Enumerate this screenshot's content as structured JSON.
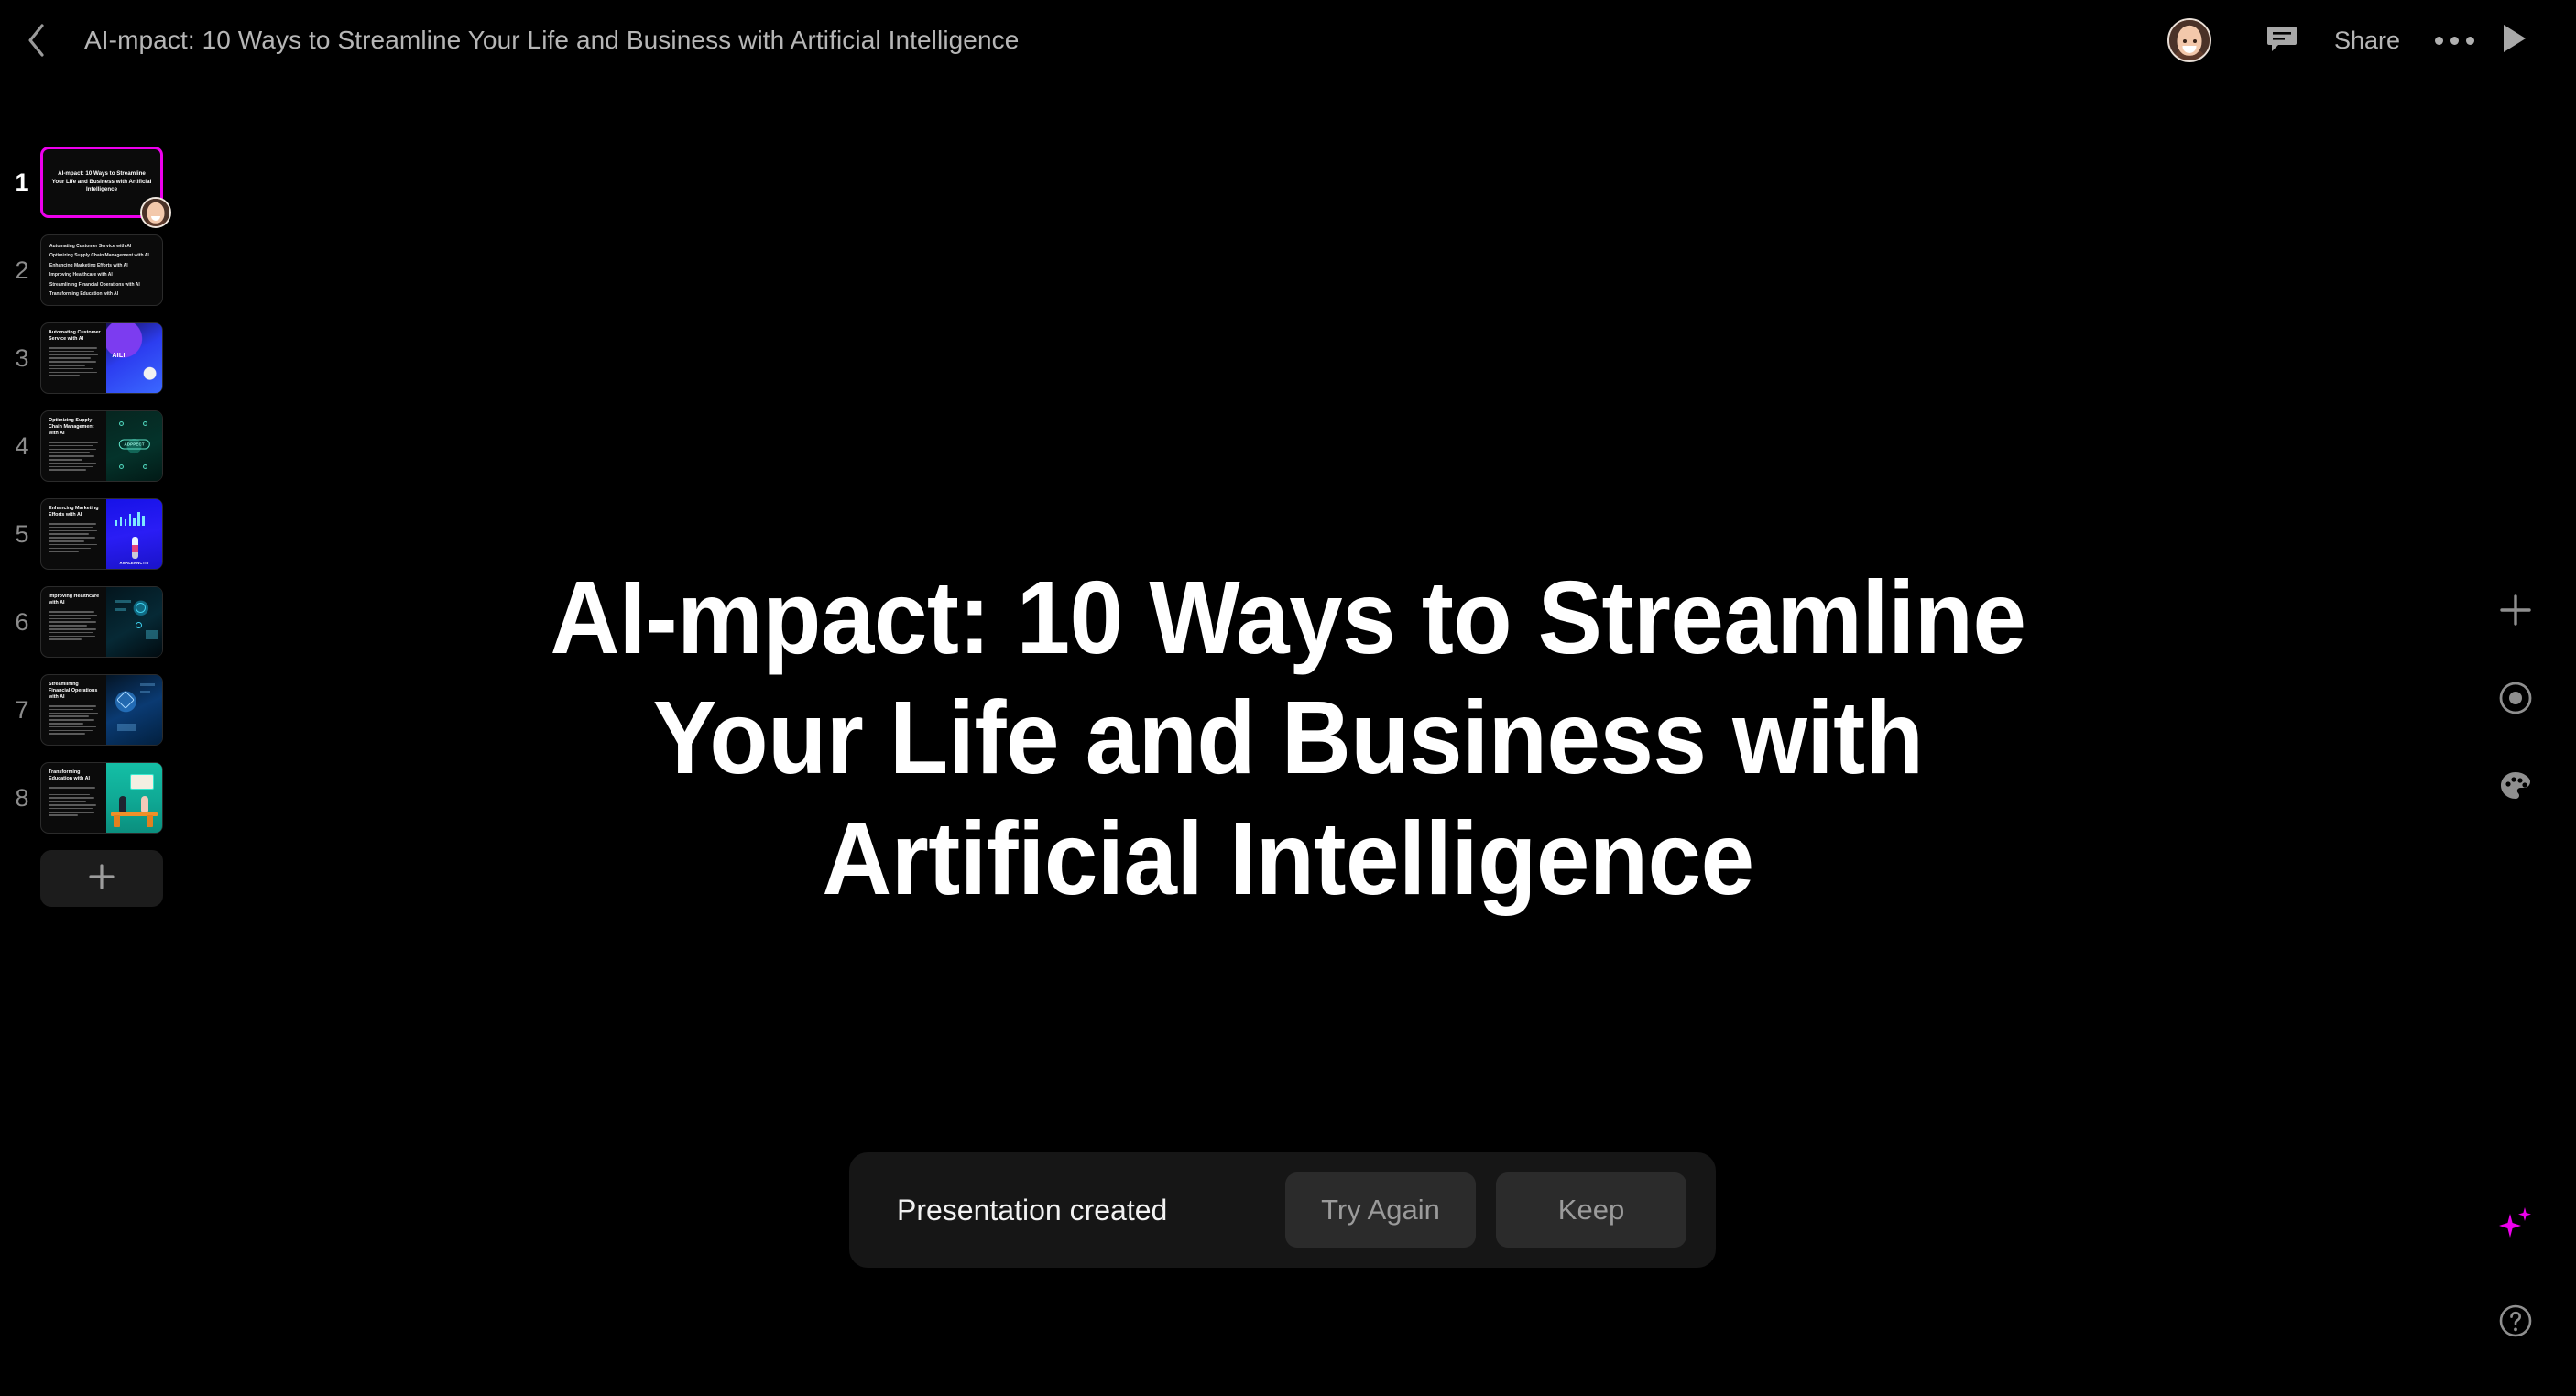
{
  "header": {
    "back_icon": "chevron-left-icon",
    "title": "AI-mpact: 10 Ways to Streamline Your Life and Business with Artificial Intelligence",
    "avatar_name": "user-avatar",
    "comment_icon": "comment-icon",
    "share_label": "Share",
    "more_icon": "ellipsis-icon",
    "play_icon": "play-icon"
  },
  "slides": [
    {
      "number": "1",
      "selected": true,
      "layout": "title",
      "title": "AI-mpact: 10 Ways to Streamline Your Life and Business with Artificial Intelligence",
      "has_avatar": true
    },
    {
      "number": "2",
      "selected": false,
      "layout": "agenda",
      "items": [
        "Automating Customer Service with AI",
        "Optimizing Supply Chain Management with AI",
        "Enhancing Marketing Efforts with AI",
        "Improving Healthcare with AI",
        "Streamlining Financial Operations with AI",
        "Transforming Education with AI"
      ]
    },
    {
      "number": "3",
      "selected": false,
      "layout": "content",
      "title": "Automating Customer Service with AI",
      "art": "art3",
      "art_label": "AILI"
    },
    {
      "number": "4",
      "selected": false,
      "layout": "content",
      "title": "Optimizing Supply Chain Management with AI",
      "art": "art4",
      "art_label": "ADPPECT"
    },
    {
      "number": "5",
      "selected": false,
      "layout": "content",
      "title": "Enhancing Marketing Efforts with AI",
      "art": "art5",
      "art_label": "ANALENNCTIV"
    },
    {
      "number": "6",
      "selected": false,
      "layout": "content",
      "title": "Improving Healthcare with AI",
      "art": "art6",
      "art_label": ""
    },
    {
      "number": "7",
      "selected": false,
      "layout": "content",
      "title": "Streamlining Financial Operations with AI",
      "art": "art7",
      "art_label": ""
    },
    {
      "number": "8",
      "selected": false,
      "layout": "content",
      "title": "Transforming Education with AI",
      "art": "art8",
      "art_label": ""
    }
  ],
  "rail": {
    "add_slide_icon": "plus-icon"
  },
  "canvas": {
    "slide_title": "AI-mpact: 10 Ways to Streamline Your Life and Business with Artificial Intelligence"
  },
  "tools": [
    {
      "icon": "plus-icon",
      "name": "add-element-button"
    },
    {
      "icon": "record-icon",
      "name": "record-button"
    },
    {
      "icon": "palette-icon",
      "name": "theme-palette-button"
    }
  ],
  "ai_button": {
    "icon": "sparkles-icon",
    "color": "#ee00ee"
  },
  "help_button": {
    "icon": "help-circle-icon"
  },
  "toast": {
    "message": "Presentation created",
    "try_again_label": "Try Again",
    "keep_label": "Keep"
  },
  "colors": {
    "background": "#000000",
    "accent_magenta": "#ee00ee",
    "text_primary": "#ffffff",
    "text_muted": "#b6b6b6",
    "surface": "#161616"
  }
}
